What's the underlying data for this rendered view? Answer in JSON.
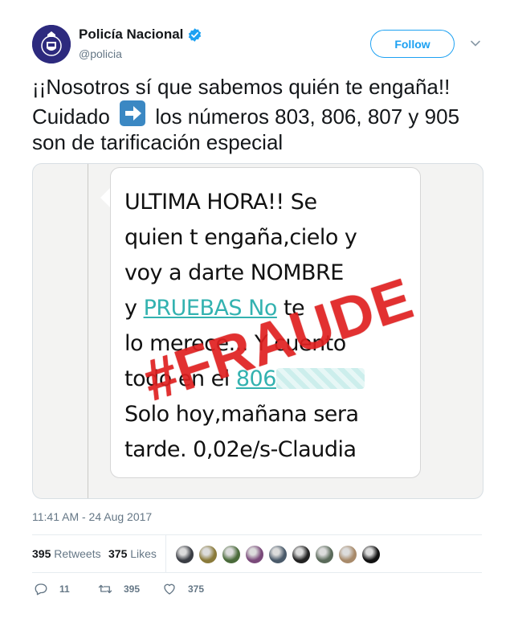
{
  "author": {
    "display_name": "Policía Nacional",
    "handle": "@policia",
    "verified": true,
    "avatar_color": "#2d2a7e"
  },
  "follow_label": "Follow",
  "tweet": {
    "line1": "¡¡Nosotros sí que sabemos quién te engaña!!",
    "line2_before": "Cuidado",
    "line2_after": "los números 803, 806, 807 y 905",
    "line3": "son de tarificación especial",
    "emoji": "right-arrow-emoji"
  },
  "media": {
    "sms_line1": "ULTIMA HORA!! Se",
    "sms_line2": "quien t engaña,cielo y",
    "sms_line3": "voy a darte NOMBRE",
    "sms_line4_a": "y",
    "sms_line4_link": "PRUEBAS No",
    "sms_line4_b": "te",
    "sms_line5": "lo merece... Y cuento",
    "sms_line6_a": "todo en el",
    "sms_line6_link": "806",
    "sms_line7": "Solo hoy,mañana sera",
    "sms_line8": "tarde. 0,02e/s-Claudia",
    "stamp": "#FRAUDE",
    "stamp_color": "#e02020",
    "link_color": "#33b2b0"
  },
  "timestamp": "11:41 AM - 24 Aug 2017",
  "stats": {
    "retweets_count": "395",
    "retweets_label": "Retweets",
    "likes_count": "375",
    "likes_label": "Likes",
    "liker_colors": [
      "#3a3d44",
      "#8a7a3a",
      "#4a6a3a",
      "#7a4a7a",
      "#4a5a6a",
      "#222222",
      "#5a6a5a",
      "#a88a6a",
      "#111111"
    ]
  },
  "actions": {
    "replies": "11",
    "retweets": "395",
    "likes": "375"
  },
  "accent_color": "#1da1f2"
}
